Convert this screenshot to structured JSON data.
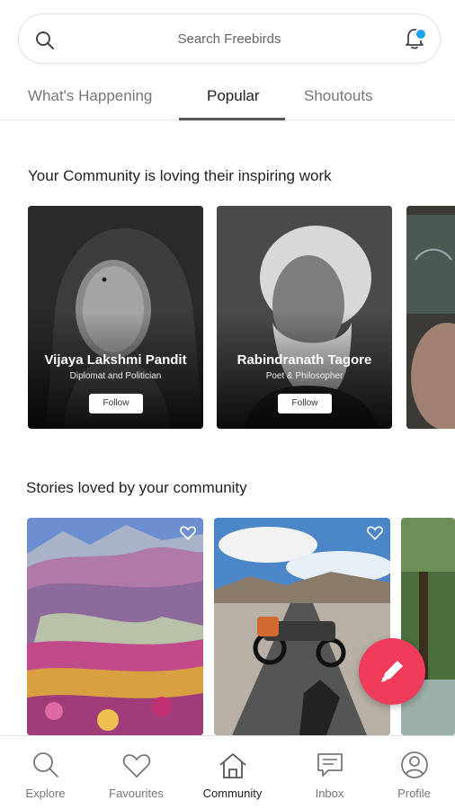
{
  "search": {
    "placeholder": "Search Freebirds"
  },
  "tabs": [
    {
      "label": "What's Happening"
    },
    {
      "label": "Popular"
    },
    {
      "label": "Shoutouts"
    }
  ],
  "active_tab": "Popular",
  "sections": {
    "inspiring": "Your Community is loving their inspiring work",
    "stories": "Stories loved by your community"
  },
  "people": [
    {
      "name": "Vijaya Lakshmi Pandit",
      "role": "Diplomat and Politician",
      "follow_label": "Follow"
    },
    {
      "name": "Rabindranath Tagore",
      "role": "Poet & Philosopher",
      "follow_label": "Follow"
    }
  ],
  "nav": [
    {
      "label": "Explore",
      "icon": "search-icon"
    },
    {
      "label": "Favourites",
      "icon": "heart-icon"
    },
    {
      "label": "Community",
      "icon": "home-icon"
    },
    {
      "label": "Inbox",
      "icon": "chat-icon"
    },
    {
      "label": "Profile",
      "icon": "user-icon"
    }
  ],
  "active_nav": "Community",
  "colors": {
    "accent": "#ef3c5b",
    "notification": "#1da1f2"
  }
}
